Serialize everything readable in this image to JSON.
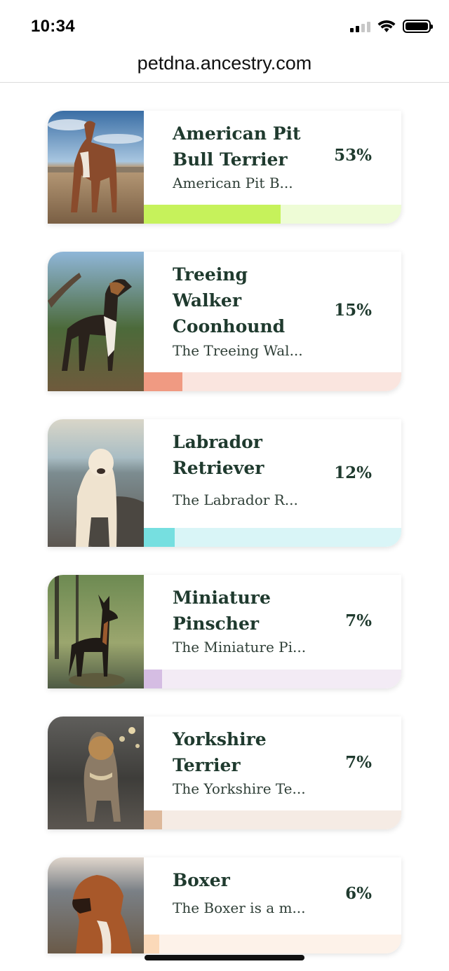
{
  "status_bar": {
    "time": "10:34"
  },
  "browser": {
    "url": "petdna.ancestry.com"
  },
  "breeds": [
    {
      "name": "American Pit Bull Terrier",
      "description": "American Pit B...",
      "percent_label": "53%",
      "percent": 53,
      "bar_color": "#c6f25b",
      "track_color": "#eefcd6",
      "image": "pit-bull-photo"
    },
    {
      "name": "Treeing Walker Coonhound",
      "description": "The Treeing Wal...",
      "percent_label": "15%",
      "percent": 15,
      "bar_color": "#f09a82",
      "track_color": "#fae5df",
      "image": "coonhound-photo"
    },
    {
      "name": "Labrador Retriever",
      "description": "The Labrador R...",
      "percent_label": "12%",
      "percent": 12,
      "bar_color": "#76dfe0",
      "track_color": "#d9f5f7",
      "image": "labrador-photo"
    },
    {
      "name": "Miniature Pinscher",
      "description": "The Miniature Pi...",
      "percent_label": "7%",
      "percent": 7,
      "bar_color": "#d5bde3",
      "track_color": "#f3ebf5",
      "image": "miniature-pinscher-photo"
    },
    {
      "name": "Yorkshire Terrier",
      "description": "The Yorkshire Te...",
      "percent_label": "7%",
      "percent": 7,
      "bar_color": "#ddb89a",
      "track_color": "#f5ebe4",
      "image": "yorkshire-terrier-photo"
    },
    {
      "name": "Boxer",
      "description": "The Boxer is a m...",
      "percent_label": "6%",
      "percent": 6,
      "bar_color": "#fbd9b9",
      "track_color": "#fdf2e9",
      "image": "boxer-photo"
    }
  ]
}
